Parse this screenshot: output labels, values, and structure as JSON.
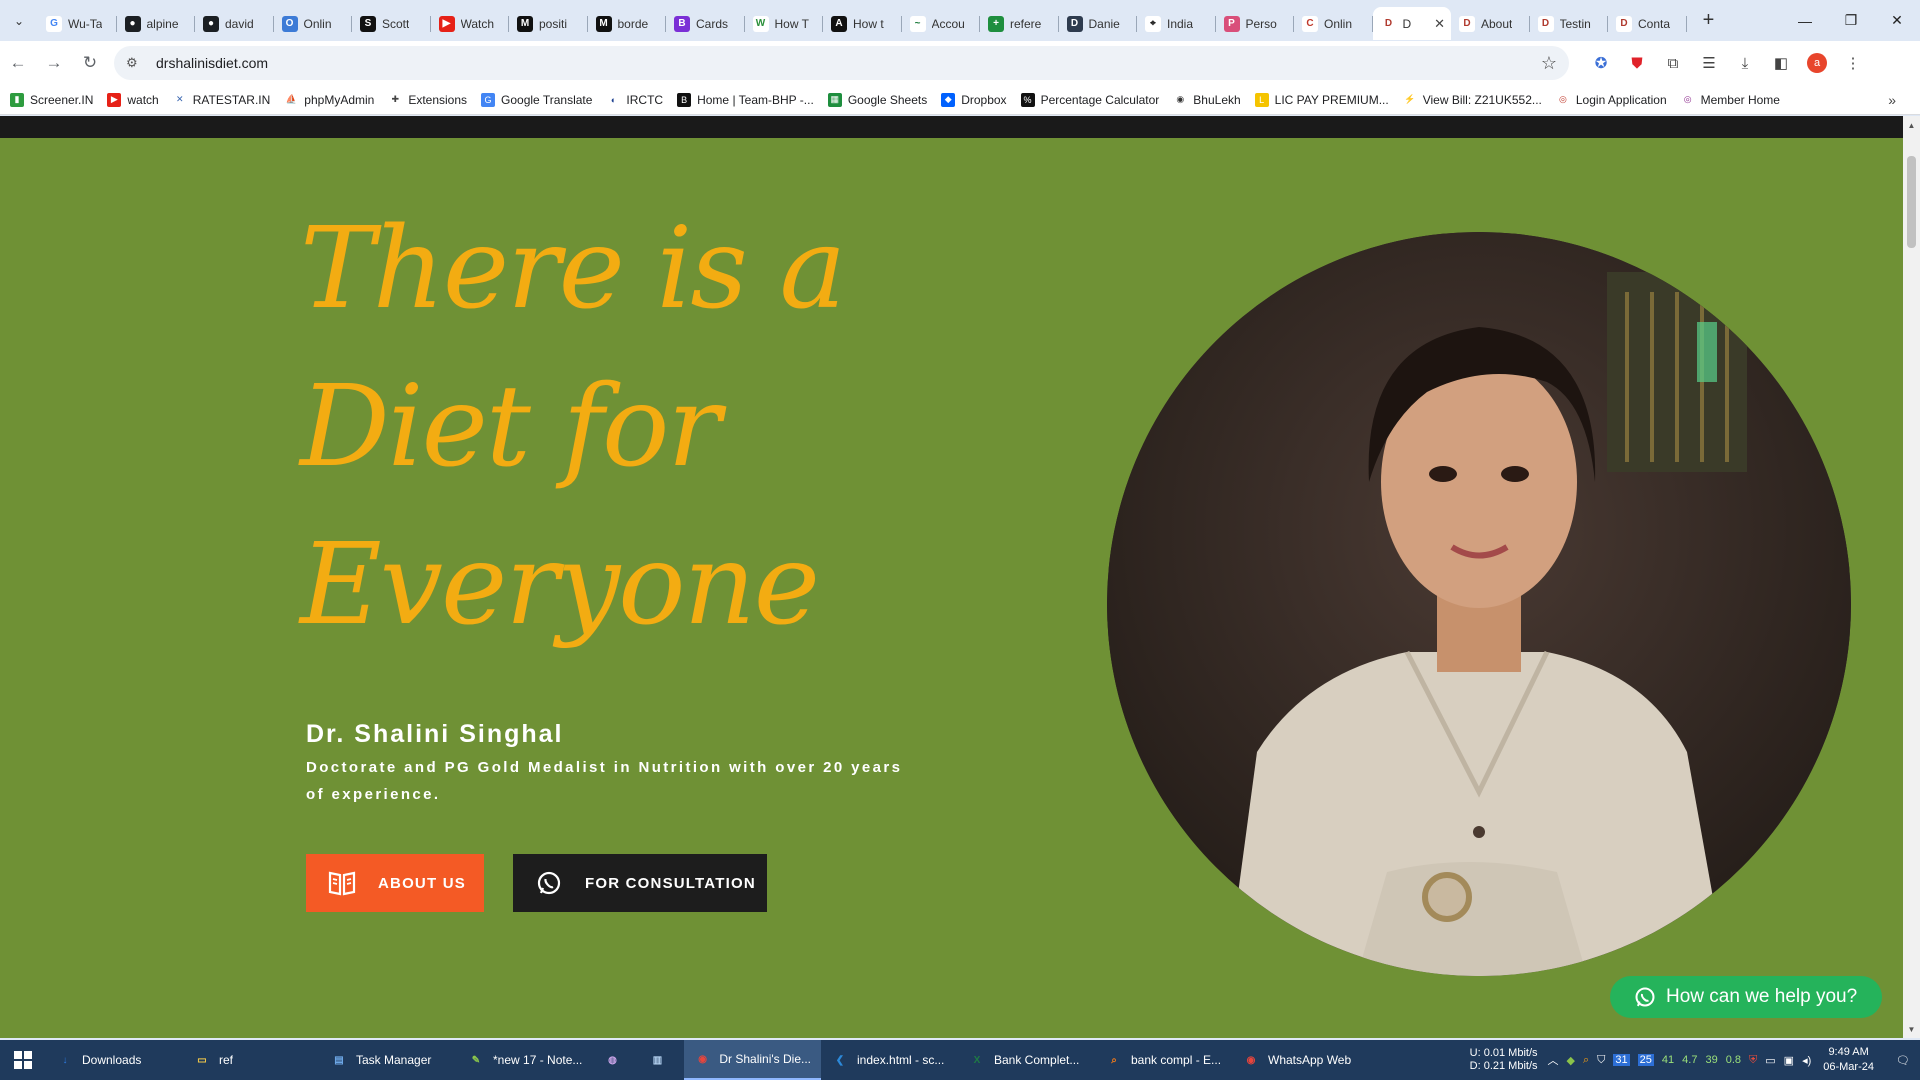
{
  "browser": {
    "tabs": [
      {
        "title": "Wu-Ta",
        "fav": "G",
        "color": "#ffffff",
        "text_color": "#4285f4"
      },
      {
        "title": "alpine",
        "fav": "gh",
        "color": "#1b1f23"
      },
      {
        "title": "david",
        "fav": "gh",
        "color": "#1b1f23"
      },
      {
        "title": "Onlin",
        "fav": "o",
        "color": "#3d7bd6"
      },
      {
        "title": "Scott",
        "fav": "S",
        "color": "#111111"
      },
      {
        "title": "Watch",
        "fav": "yt",
        "color": "#e62117"
      },
      {
        "title": "positi",
        "fav": "M",
        "color": "#111111"
      },
      {
        "title": "borde",
        "fav": "M",
        "color": "#111111"
      },
      {
        "title": "Cards",
        "fav": "B",
        "color": "#7b2fd6"
      },
      {
        "title": "How T",
        "fav": "W",
        "color": "#ffffff",
        "text_color": "#2a8f3a"
      },
      {
        "title": "How t",
        "fav": "A",
        "color": "#111111"
      },
      {
        "title": "Accou",
        "fav": "~",
        "color": "#ffffff",
        "text_color": "#1a7a3a"
      },
      {
        "title": "refere",
        "fav": "+",
        "color": "#1e8e3e"
      },
      {
        "title": "Danie",
        "fav": "d",
        "color": "#2e3b4e"
      },
      {
        "title": "India",
        "fav": "pin",
        "color": "#ffffff",
        "text_color": "#111111"
      },
      {
        "title": "Perso",
        "fav": "p",
        "color": "#d94f7a"
      },
      {
        "title": "Onlin",
        "fav": "c",
        "color": "#ffffff",
        "text_color": "#c0392b"
      },
      {
        "title": "D",
        "fav": "d",
        "color": "#ffffff",
        "text_color": "#b03a2e",
        "active": true
      },
      {
        "title": "About",
        "fav": "d",
        "color": "#ffffff",
        "text_color": "#b03a2e"
      },
      {
        "title": "Testin",
        "fav": "d",
        "color": "#ffffff",
        "text_color": "#b03a2e"
      },
      {
        "title": "Conta",
        "fav": "d",
        "color": "#ffffff",
        "text_color": "#b03a2e"
      }
    ],
    "url": "drshalinisdiet.com",
    "profile_initial": "a"
  },
  "bookmarks": [
    {
      "label": "Screener.IN",
      "color": "#2e9c3f",
      "glyph": "▮"
    },
    {
      "label": "watch",
      "color": "#e62117",
      "glyph": "▶"
    },
    {
      "label": "RATESTAR.IN",
      "color": "#ffffff",
      "glyph": "✕",
      "glyph_color": "#3a66b0"
    },
    {
      "label": "phpMyAdmin",
      "color": "#ffffff",
      "glyph": "⛵",
      "glyph_color": "#e08a1e"
    },
    {
      "label": "Extensions",
      "color": "#ffffff",
      "glyph": "✚",
      "glyph_color": "#444444"
    },
    {
      "label": "Google Translate",
      "color": "#4285f4",
      "glyph": "G"
    },
    {
      "label": "IRCTC",
      "color": "#ffffff",
      "glyph": "◐",
      "glyph_color": "#1b3f8f"
    },
    {
      "label": "Home | Team-BHP -...",
      "color": "#111111",
      "glyph": "B"
    },
    {
      "label": "Google Sheets",
      "color": "#1e8e3e",
      "glyph": "▦"
    },
    {
      "label": "Dropbox",
      "color": "#0061fe",
      "glyph": "◆"
    },
    {
      "label": "Percentage Calculator",
      "color": "#111111",
      "glyph": "%"
    },
    {
      "label": "BhuLekh",
      "color": "#ffffff",
      "glyph": "◉",
      "glyph_color": "#333333"
    },
    {
      "label": "LIC PAY PREMIUM...",
      "color": "#f5c400",
      "glyph": "L"
    },
    {
      "label": "View Bill: Z21UK552...",
      "color": "#ffffff",
      "glyph": "⚡",
      "glyph_color": "#2a5db0"
    },
    {
      "label": "Login Application",
      "color": "#ffffff",
      "glyph": "◎",
      "glyph_color": "#c0392b"
    },
    {
      "label": "Member Home",
      "color": "#ffffff",
      "glyph": "◎",
      "glyph_color": "#8e2d8e"
    }
  ],
  "hero": {
    "headline_lines": [
      "There is a",
      "Diet for",
      "Everyone"
    ],
    "name": "Dr. Shalini Singhal",
    "tagline": "Doctorate and PG Gold Medalist in Nutrition with over 20 years of experience.",
    "about_button": "ABOUT US",
    "consult_button": "FOR CONSULTATION",
    "help_button": "How can we help you?",
    "colors": {
      "background": "#6f9135",
      "headline": "#f3ac12",
      "about_bg": "#f45a25",
      "consult_bg": "#1d1d1d",
      "help_bg": "#25b35b"
    }
  },
  "taskbar": {
    "items": [
      {
        "label": "Downloads",
        "icon": "download-icon",
        "color": "#2d7be0",
        "glyph": "↓"
      },
      {
        "label": "ref",
        "icon": "folder-icon",
        "color": "#f3c94a",
        "glyph": "▭"
      },
      {
        "label": "Task Manager",
        "icon": "task-manager-icon",
        "color": "#6da7e6",
        "glyph": "▤"
      },
      {
        "label": "*new 17 - Note...",
        "icon": "notepad-plus-icon",
        "color": "#8cc84b",
        "glyph": "✎"
      },
      {
        "label": "",
        "icon": "app-icon",
        "color": "#c9a3e8",
        "glyph": "◍"
      },
      {
        "label": "",
        "icon": "notepad-icon",
        "color": "#b8d6f5",
        "glyph": "▥"
      },
      {
        "label": "Dr Shalini's Die...",
        "icon": "chrome-icon",
        "color": "#e8453c",
        "glyph": "◉",
        "active": true
      },
      {
        "label": "index.html - sc...",
        "icon": "vscode-icon",
        "color": "#2c89d9",
        "glyph": "❮"
      },
      {
        "label": "Bank Complet...",
        "icon": "excel-icon",
        "color": "#1e7a45",
        "glyph": "X"
      },
      {
        "label": "bank compl - E...",
        "icon": "search-tool-icon",
        "color": "#f27b1a",
        "glyph": "⌕"
      },
      {
        "label": "WhatsApp Web",
        "icon": "chrome-icon",
        "color": "#e8453c",
        "glyph": "◉"
      }
    ],
    "net_up": "U:   0.01 Mbit/s",
    "net_down": "D:   0.21 Mbit/s",
    "tray_values": [
      "31",
      "25",
      "41",
      "4.7",
      "39",
      "0.8"
    ],
    "time": "9:49 AM",
    "date": "06-Mar-24"
  }
}
